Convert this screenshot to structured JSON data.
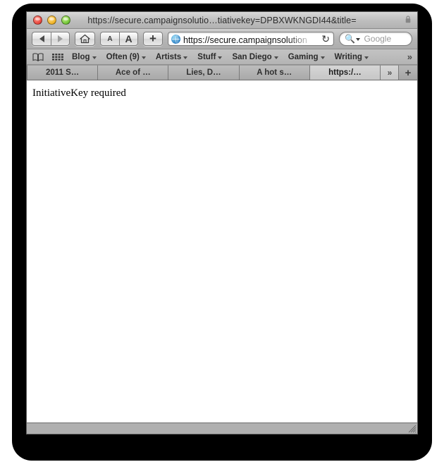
{
  "window": {
    "title": "https://secure.campaignsolutio…tiativekey=DPBXWKNGDI44&title=",
    "lock_icon": "lock-icon",
    "traffic_lights": [
      {
        "name": "close-button",
        "color": "#e8443a"
      },
      {
        "name": "minimize-button",
        "color": "#f0b323"
      },
      {
        "name": "zoom-button",
        "color": "#71c435"
      }
    ]
  },
  "toolbar": {
    "back_icon": "back-arrow-icon",
    "forward_icon": "forward-arrow-icon",
    "home_icon": "home-icon",
    "text_smaller_label": "A",
    "text_larger_label": "A",
    "add_bookmark_label": "+",
    "url_value": "https://secure.campaignsolution",
    "url_site_icon": "globe-icon",
    "reload_icon": "↻",
    "search_icon": "search-icon",
    "search_placeholder": "Google"
  },
  "bookmarks_bar": {
    "show_all_bookmarks_icon": "book-icon",
    "top_sites_icon": "grid-icon",
    "items": [
      {
        "label": "Blog"
      },
      {
        "label": "Often (9)"
      },
      {
        "label": "Artists"
      },
      {
        "label": "Stuff"
      },
      {
        "label": "San Diego"
      },
      {
        "label": "Gaming"
      },
      {
        "label": "Writing"
      }
    ],
    "overflow_label": "»"
  },
  "tab_bar": {
    "tabs": [
      {
        "label": "2011 S…",
        "active": false
      },
      {
        "label": "Ace of …",
        "active": false
      },
      {
        "label": "Lies, D…",
        "active": false
      },
      {
        "label": "A hot s…",
        "active": false
      },
      {
        "label": "https:/…",
        "active": true
      }
    ],
    "overflow_label": "»",
    "new_tab_label": "+"
  },
  "content": {
    "body_text": "InitiativeKey required"
  },
  "statusbar": {
    "resize_grip_icon": "resize-grip-icon"
  },
  "colors": {
    "frame": "#000000",
    "chrome": "#b6b6b6",
    "content_bg": "#ffffff",
    "statusbar": "#b0b0b0"
  }
}
